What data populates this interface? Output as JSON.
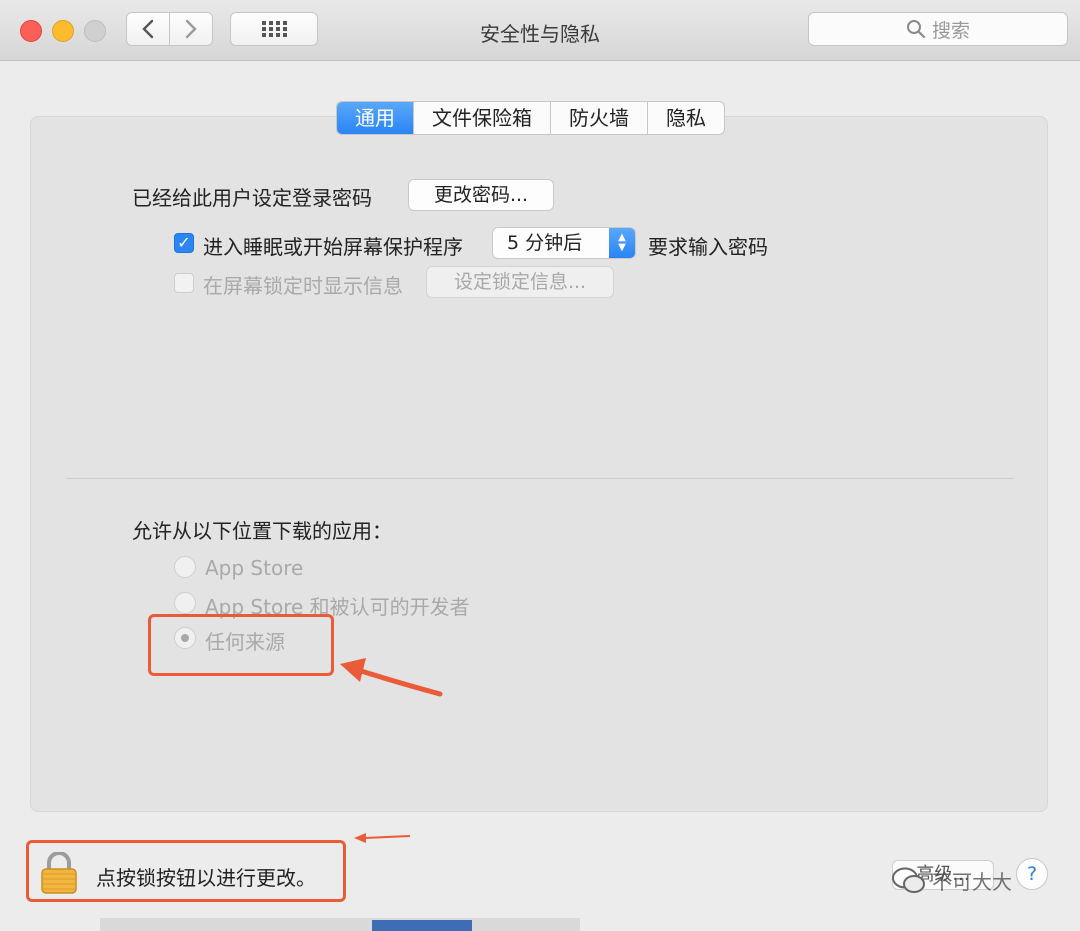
{
  "window": {
    "title": "安全性与隐私",
    "search_placeholder": "搜索"
  },
  "tabs": [
    {
      "label": "通用",
      "active": true
    },
    {
      "label": "文件保险箱",
      "active": false
    },
    {
      "label": "防火墙",
      "active": false
    },
    {
      "label": "隐私",
      "active": false
    }
  ],
  "general": {
    "password_set_label": "已经给此用户设定登录密码",
    "change_password_button": "更改密码...",
    "require_password": {
      "checked": true,
      "label": "进入睡眠或开始屏幕保护程序",
      "delay_value": "5 分钟后",
      "suffix": "要求输入密码"
    },
    "lock_message": {
      "checked": false,
      "enabled": false,
      "label": "在屏幕锁定时显示信息",
      "button": "设定锁定信息..."
    }
  },
  "downloads": {
    "heading": "允许从以下位置下载的应用：",
    "options": [
      {
        "label": "App Store",
        "selected": false
      },
      {
        "label": "App Store 和被认可的开发者",
        "selected": false
      },
      {
        "label": "任何来源",
        "selected": true
      }
    ]
  },
  "footer": {
    "lock_text": "点按锁按钮以进行更改。",
    "advanced_button": "高级...",
    "help_button": "?",
    "watermark": "不可大大"
  },
  "colors": {
    "accent": "#2d84f3",
    "annotation": "#ea5b38"
  },
  "icons": [
    "back-chevron-icon",
    "forward-chevron-icon",
    "grid-icon",
    "search-icon",
    "lock-icon",
    "annotation-arrow-icon",
    "wechat-icon"
  ]
}
